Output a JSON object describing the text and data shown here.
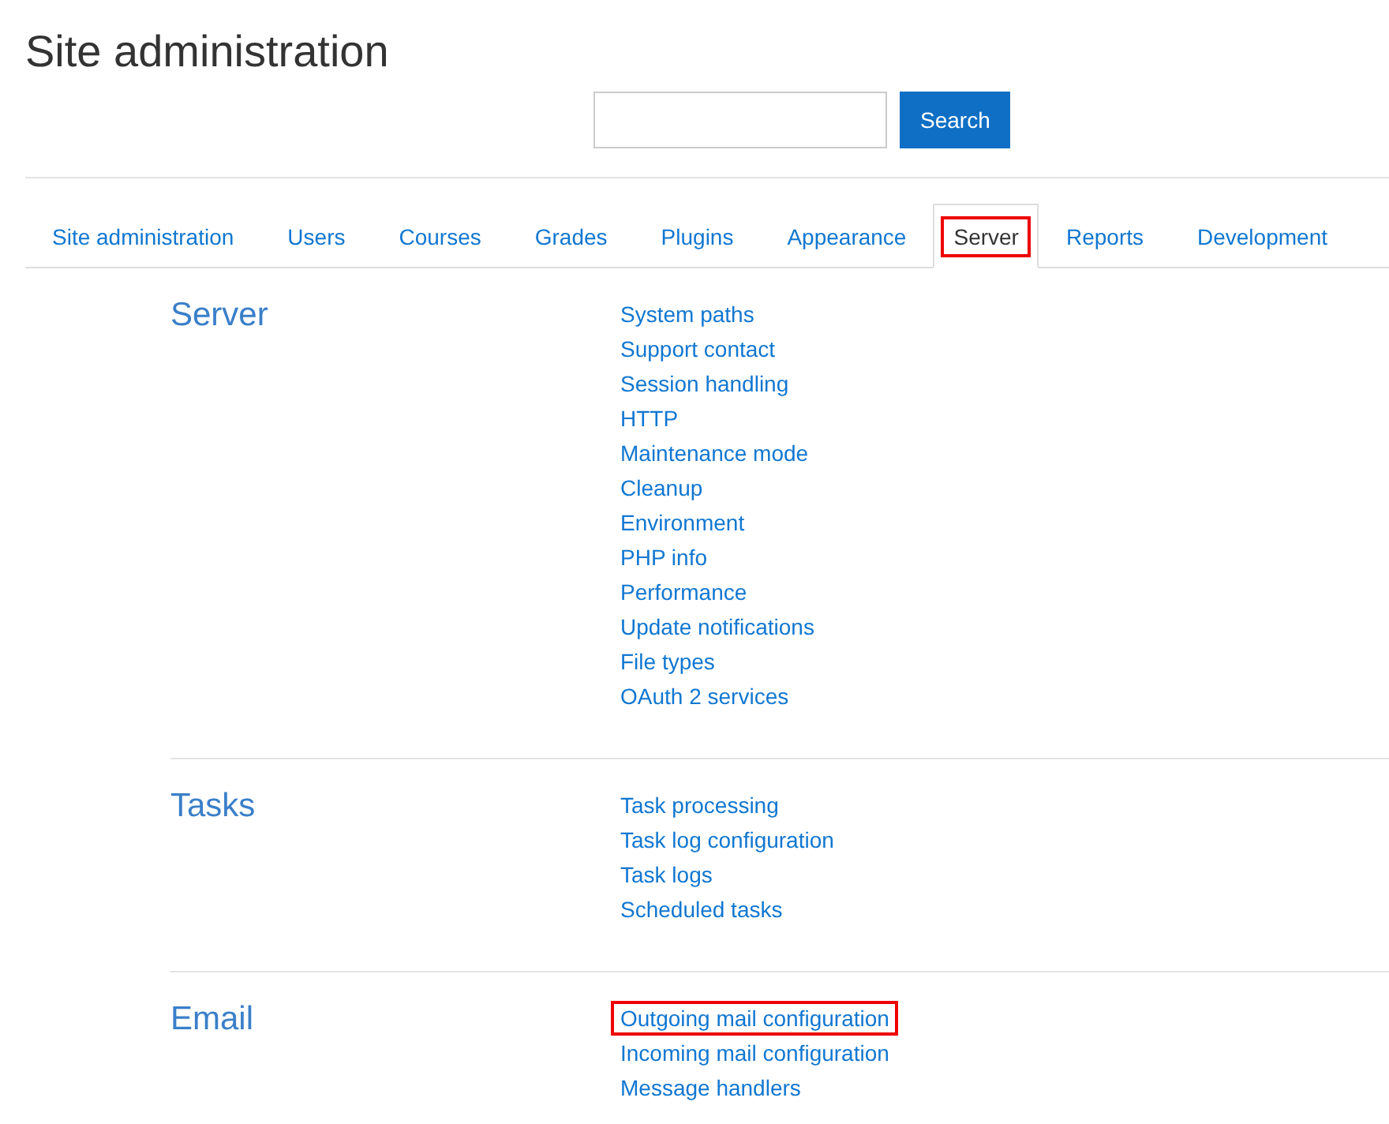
{
  "page_title": "Site administration",
  "search": {
    "button": "Search"
  },
  "tabs": [
    {
      "label": "Site administration",
      "selected": false,
      "highlighted": false
    },
    {
      "label": "Users",
      "selected": false,
      "highlighted": false
    },
    {
      "label": "Courses",
      "selected": false,
      "highlighted": false
    },
    {
      "label": "Grades",
      "selected": false,
      "highlighted": false
    },
    {
      "label": "Plugins",
      "selected": false,
      "highlighted": false
    },
    {
      "label": "Appearance",
      "selected": false,
      "highlighted": false
    },
    {
      "label": "Server",
      "selected": true,
      "highlighted": true
    },
    {
      "label": "Reports",
      "selected": false,
      "highlighted": false
    },
    {
      "label": "Development",
      "selected": false,
      "highlighted": false
    }
  ],
  "sections": [
    {
      "heading": "Server",
      "links": [
        {
          "label": "System paths",
          "highlighted": false
        },
        {
          "label": "Support contact",
          "highlighted": false
        },
        {
          "label": "Session handling",
          "highlighted": false
        },
        {
          "label": "HTTP",
          "highlighted": false
        },
        {
          "label": "Maintenance mode",
          "highlighted": false
        },
        {
          "label": "Cleanup",
          "highlighted": false
        },
        {
          "label": "Environment",
          "highlighted": false
        },
        {
          "label": "PHP info",
          "highlighted": false
        },
        {
          "label": "Performance",
          "highlighted": false
        },
        {
          "label": "Update notifications",
          "highlighted": false
        },
        {
          "label": "File types",
          "highlighted": false
        },
        {
          "label": "OAuth 2 services",
          "highlighted": false
        }
      ]
    },
    {
      "heading": "Tasks",
      "links": [
        {
          "label": "Task processing",
          "highlighted": false
        },
        {
          "label": "Task log configuration",
          "highlighted": false
        },
        {
          "label": "Task logs",
          "highlighted": false
        },
        {
          "label": "Scheduled tasks",
          "highlighted": false
        }
      ]
    },
    {
      "heading": "Email",
      "links": [
        {
          "label": "Outgoing mail configuration",
          "highlighted": true
        },
        {
          "label": "Incoming mail configuration",
          "highlighted": false
        },
        {
          "label": "Message handlers",
          "highlighted": false
        }
      ]
    }
  ]
}
